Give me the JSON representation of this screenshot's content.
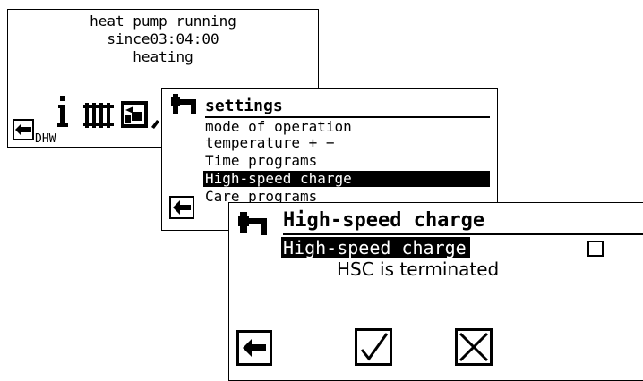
{
  "screen_main": {
    "status_line1": "heat pump running",
    "status_line2": "since03:04:00",
    "status_line3": "heating",
    "icons": [
      "back-arrow-icon",
      "info-icon",
      "radiator-icon",
      "heating-curve-icon",
      "tap-icon"
    ],
    "info_sub_label": "DHW"
  },
  "screen_settings": {
    "title": "settings",
    "items": [
      {
        "label": "mode of operation"
      },
      {
        "label": "temperature + −"
      },
      {
        "label": "Time programs"
      },
      {
        "label": "High-speed charge"
      },
      {
        "label": "Care programs"
      }
    ],
    "selected_index": 3
  },
  "screen_hsc": {
    "title": "High-speed charge",
    "option_label": "High-speed charge",
    "checkbox_checked": false,
    "status_text": "HSC is terminated",
    "buttons": [
      "back-arrow-icon",
      "confirm-check-icon",
      "cancel-cross-icon"
    ]
  }
}
